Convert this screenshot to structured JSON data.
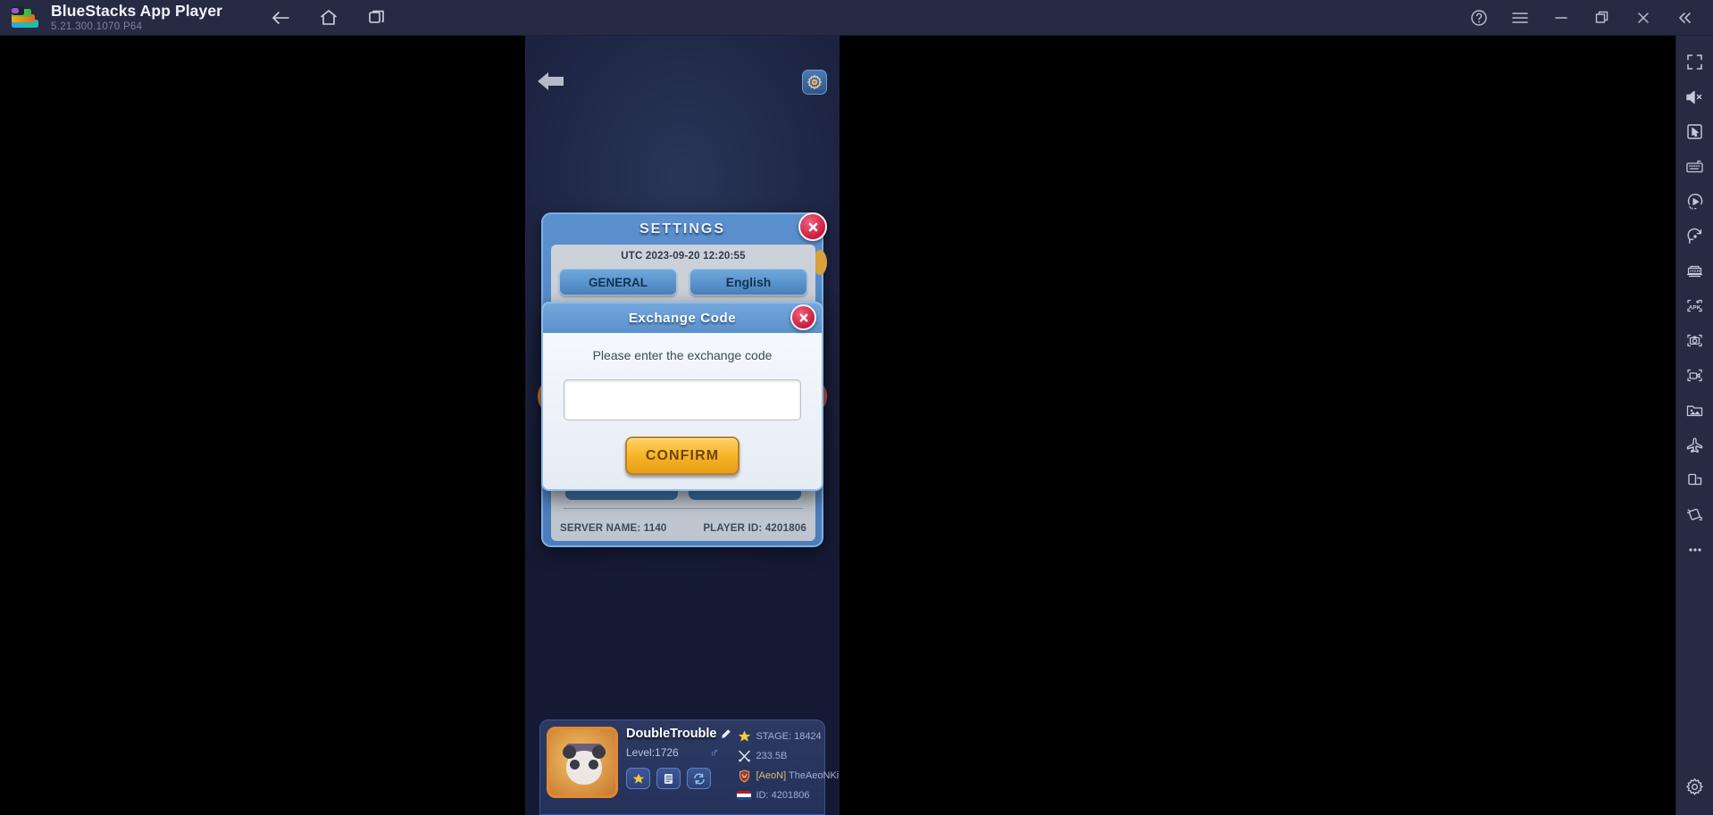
{
  "titlebar": {
    "app_title": "BlueStacks App Player",
    "version": "5.21.300.1070  P64",
    "nav": [
      {
        "name": "back-button",
        "icon": "arrow-left-icon"
      },
      {
        "name": "home-button",
        "icon": "home-icon"
      },
      {
        "name": "instance-manager-button",
        "icon": "windows-icon"
      }
    ],
    "window_controls": [
      {
        "name": "help-button",
        "icon": "question-circle-icon"
      },
      {
        "name": "menu-button",
        "icon": "hamburger-icon"
      },
      {
        "name": "minimize-button",
        "icon": "minimize-icon"
      },
      {
        "name": "maximize-button",
        "icon": "restore-icon"
      },
      {
        "name": "close-button",
        "icon": "close-icon"
      },
      {
        "name": "collapse-sidebar-button",
        "icon": "chevron-double-left-icon"
      }
    ]
  },
  "sidebar": {
    "items": [
      {
        "name": "fullscreen-button",
        "icon": "fullscreen-icon"
      },
      {
        "name": "mute-button",
        "icon": "speaker-mute-icon"
      },
      {
        "name": "cursor-button",
        "icon": "cursor-pointer-icon"
      },
      {
        "name": "keyboard-controls-button",
        "icon": "keyboard-icon"
      },
      {
        "name": "macro-recorder-button",
        "icon": "play-circle-icon"
      },
      {
        "name": "rotate-button",
        "icon": "rotate-icon"
      },
      {
        "name": "gamepad-controls-button",
        "icon": "gamepad-icon"
      },
      {
        "name": "install-apk-button",
        "icon": "apk-icon"
      },
      {
        "name": "screenshot-button",
        "icon": "camera-icon"
      },
      {
        "name": "record-screen-button",
        "icon": "video-camera-icon"
      },
      {
        "name": "media-manager-button",
        "icon": "image-folder-icon"
      },
      {
        "name": "eco-mode-button",
        "icon": "airplane-icon"
      },
      {
        "name": "multi-instance-button",
        "icon": "multi-window-icon"
      },
      {
        "name": "shake-button",
        "icon": "shake-icon"
      },
      {
        "name": "more-button",
        "icon": "ellipsis-icon"
      },
      {
        "name": "settings-button",
        "icon": "gear-icon"
      }
    ]
  },
  "game": {
    "back_icon": "arrow-left-icon",
    "gear_icon": "gear-icon",
    "settings_panel": {
      "title": "SETTINGS",
      "close_icon": "close-x-icon",
      "utc_time": "UTC 2023-09-20 12:20:55",
      "buttons": [
        {
          "name": "general-tab-button",
          "label": "GENERAL"
        },
        {
          "name": "language-button",
          "label": "English"
        }
      ],
      "server_name": "SERVER NAME: 1140",
      "player_id": "PLAYER ID: 4201806"
    },
    "exchange_modal": {
      "title": "Exchange Code",
      "close_icon": "close-x-icon",
      "prompt": "Please enter the exchange code",
      "input_value": "",
      "input_placeholder": "",
      "confirm_label": "CONFIRM"
    },
    "player_card": {
      "avatar_icon": "panda-avatar-icon",
      "name": "DoubleTrouble",
      "edit_icon": "pencil-icon",
      "level": "Level:1726",
      "gender_icon": "male-icon",
      "actions": [
        {
          "name": "achievements-button",
          "icon": "star-icon"
        },
        {
          "name": "notes-button",
          "icon": "document-icon"
        },
        {
          "name": "switch-account-button",
          "icon": "refresh-icon"
        }
      ],
      "stats": [
        {
          "name": "stage-stat",
          "icon": "star-icon",
          "text": "STAGE: 18424"
        },
        {
          "name": "damage-stat",
          "icon": "swords-icon",
          "text": "233.5B"
        },
        {
          "name": "guild-stat",
          "icon": "guild-shield-icon",
          "tag": "[AeoN]",
          "text": "TheAeoNKings"
        },
        {
          "name": "id-stat",
          "icon": "flag-icon",
          "text": "ID: 4201806"
        }
      ]
    }
  }
}
